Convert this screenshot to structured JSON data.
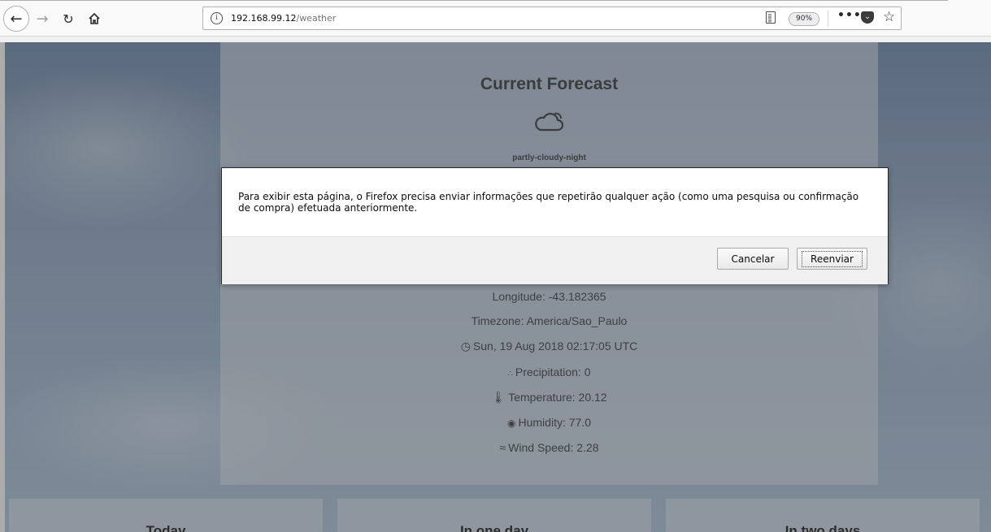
{
  "browser": {
    "url_host": "192.168.99.12",
    "url_path": "/weather",
    "zoom": "90%"
  },
  "forecast": {
    "title": "Current Forecast",
    "icon": "cloud-icon",
    "condition": "partly-cloudy-night",
    "longitude": "Longitude: -43.182365",
    "timezone": "Timezone: America/Sao_Paulo",
    "time": "Sun, 19 Aug 2018 02:17:05 UTC",
    "precipitation": "Precipitation: 0",
    "temperature": "Temperature: 20.12",
    "humidity": "Humidity: 77.0",
    "wind_speed": "Wind Speed: 2.28"
  },
  "cards": {
    "today": "Today",
    "one_day": "In one day",
    "two_days": "In two days"
  },
  "dialog": {
    "message": "Para exibir esta página, o Firefox precisa enviar informações que repetirão qualquer ação (como uma pesquisa ou confirmação de compra) efetuada anteriormente.",
    "cancel_label": "Cancelar",
    "resend_label": "Reenviar"
  }
}
